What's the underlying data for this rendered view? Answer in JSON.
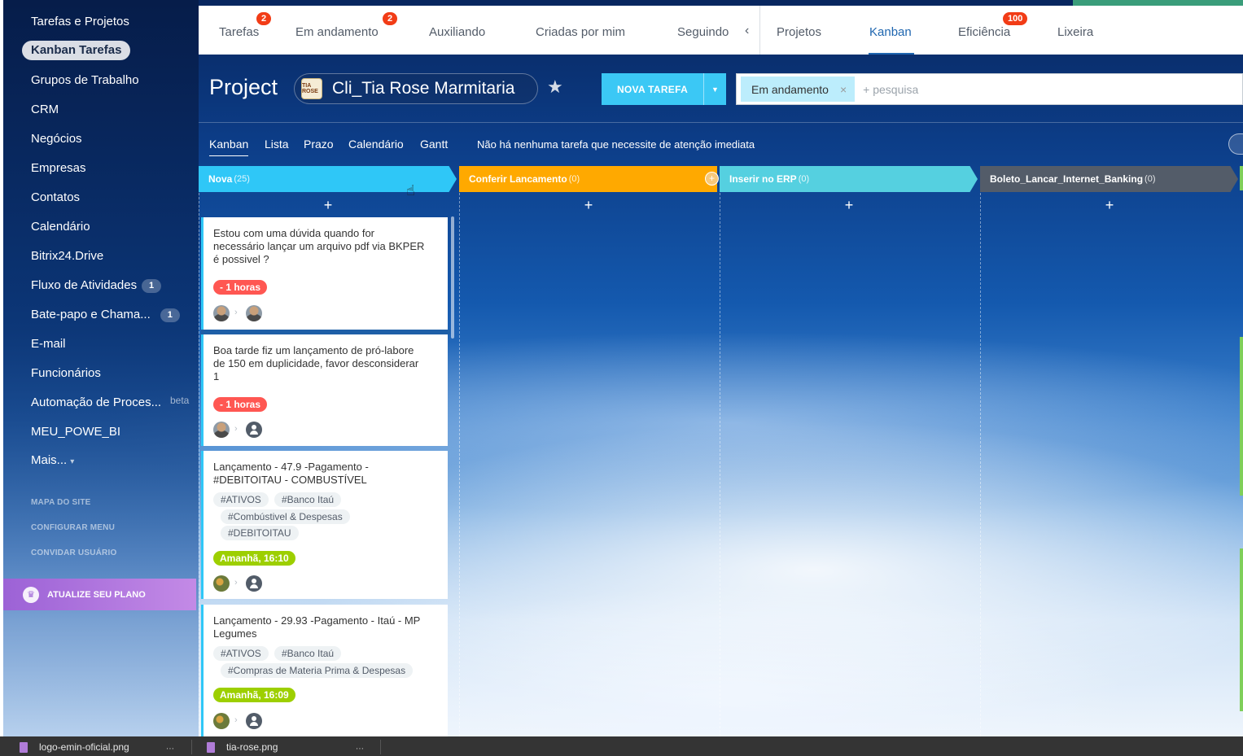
{
  "sidebar": {
    "items": [
      {
        "label": "Tarefas e Projetos"
      },
      {
        "label": "Kanban Tarefas"
      },
      {
        "label": "Grupos de Trabalho"
      },
      {
        "label": "CRM"
      },
      {
        "label": "Negócios"
      },
      {
        "label": "Empresas"
      },
      {
        "label": "Contatos"
      },
      {
        "label": "Calendário"
      },
      {
        "label": "Bitrix24.Drive"
      },
      {
        "label": "Fluxo de Atividades",
        "counter": "1"
      },
      {
        "label": "Bate-papo e Chama...",
        "counter": "1"
      },
      {
        "label": "E-mail"
      },
      {
        "label": "Funcionários"
      },
      {
        "label": "Automação de Proces...",
        "tag": "beta"
      },
      {
        "label": "MEU_POWE_BI"
      },
      {
        "label": "Mais..."
      }
    ],
    "links": [
      "MAPA DO SITE",
      "CONFIGURAR MENU",
      "CONVIDAR USUÁRIO"
    ],
    "upgrade_label": "ATUALIZE SEU PLANO"
  },
  "top_tabs": [
    {
      "label": "Tarefas",
      "badge": "2"
    },
    {
      "label": "Em andamento",
      "badge": "2"
    },
    {
      "label": "Auxiliando"
    },
    {
      "label": "Criadas por mim"
    },
    {
      "label": "Seguindo"
    },
    {
      "label": "Projetos"
    },
    {
      "label": "Kanban"
    },
    {
      "label": "Eficiência",
      "badge": "100"
    },
    {
      "label": "Lixeira"
    }
  ],
  "header": {
    "title": "Project",
    "project_name": "Cli_Tia Rose Marmitaria",
    "new_task_label": "NOVA TAREFA",
    "filter_chip": "Em andamento",
    "search_placeholder": "+ pesquisa"
  },
  "views": [
    "Kanban",
    "Lista",
    "Prazo",
    "Calendário",
    "Gantt"
  ],
  "notice": "Não há nenhuma tarefa que necessite de atenção imediata",
  "columns": [
    {
      "name": "Nova",
      "count": "(25)",
      "color": "#2fc7f7"
    },
    {
      "name": "Conferir Lancamento",
      "count": "(0)",
      "color": "#ffa900"
    },
    {
      "name": "Inserir no ERP",
      "count": "(0)",
      "color": "#55d0e0"
    },
    {
      "name": "Boleto_Lancar_Internet_Banking",
      "count": "(0)",
      "color": "#535c69"
    }
  ],
  "cards": [
    {
      "title": "Estou com uma dúvida quando for necessário lançar um arquivo pdf via BKPER é possivel ?",
      "deadline": "- 1 horas",
      "tags": []
    },
    {
      "title": "Boa tarde fiz um lançamento de pró-labore de 150 em duplicidade, favor desconsiderar 1",
      "deadline": "- 1 horas",
      "tags": []
    },
    {
      "title": "Lançamento - 47.9 -Pagamento - #DEBITOITAU - COMBUSTÍVEL",
      "deadline": "Amanhã, 16:10",
      "tags": [
        "#ATIVOS",
        "#Banco Itaú",
        "#Combústivel & Despesas",
        "#DEBITOITAU"
      ]
    },
    {
      "title": "Lançamento - 29.93 -Pagamento - Itaú - MP Legumes",
      "deadline": "Amanhã, 16:09",
      "tags": [
        "#ATIVOS",
        "#Banco Itaú",
        "#Compras de Materia Prima & Despesas"
      ]
    }
  ],
  "taskbar": {
    "files": [
      "logo-emin-oficial.png",
      "tia-rose.png"
    ]
  },
  "colors": {
    "accent": "#2067b0",
    "badge": "#f23c16",
    "primary_button": "#3bc8f5",
    "upgrade": "#9c62d6"
  }
}
